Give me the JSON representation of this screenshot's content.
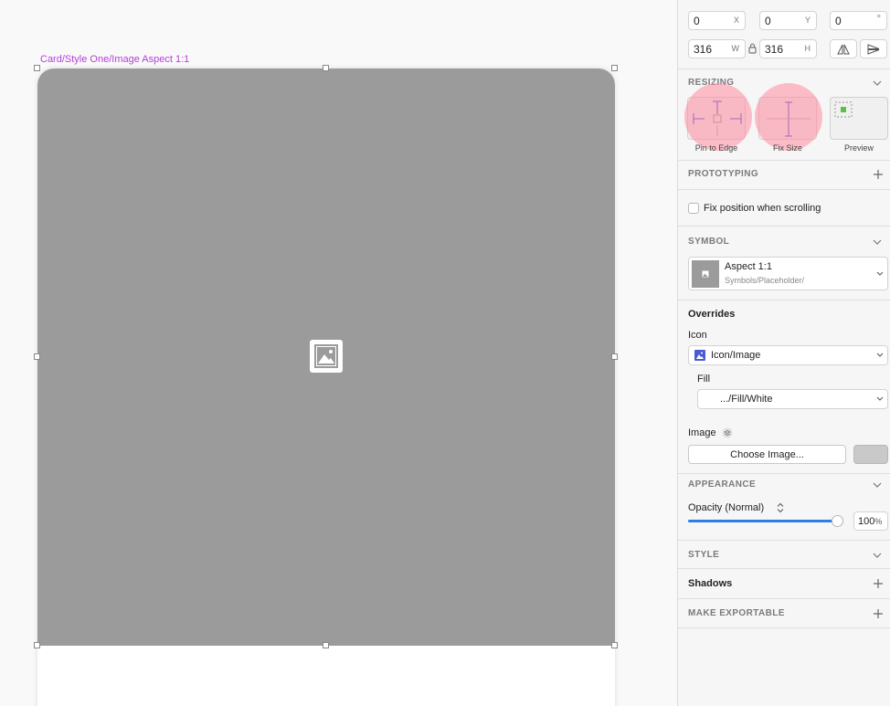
{
  "canvas": {
    "artboard_label": "Card/Style One/Image Aspect 1:1",
    "placeholder_color": "#9b9b9b",
    "label_color": "#b43fd8"
  },
  "inspector": {
    "position": {
      "x": "0",
      "x_unit": "X",
      "y": "0",
      "y_unit": "Y",
      "rotation": "0",
      "rotation_unit": "°",
      "width": "316",
      "width_unit": "W",
      "height": "316",
      "height_unit": "H"
    },
    "resizing": {
      "title": "RESIZING",
      "pin_label": "Pin to Edge",
      "fix_label": "Fix Size",
      "preview_label": "Preview"
    },
    "prototyping": {
      "title": "PROTOTYPING",
      "fix_position_label": "Fix position when scrolling"
    },
    "symbol": {
      "title": "SYMBOL",
      "name": "Aspect 1:1",
      "path": "Symbols/Placeholder/"
    },
    "overrides": {
      "title": "Overrides",
      "icon_label": "Icon",
      "icon_value": "Icon/Image",
      "fill_label": "Fill",
      "fill_value": ".../Fill/White",
      "image_label": "Image",
      "choose_image_label": "Choose Image..."
    },
    "appearance": {
      "title": "APPEARANCE",
      "opacity_label": "Opacity (Normal)",
      "opacity_value": "100",
      "opacity_unit": "%",
      "opacity_level": 1.0
    },
    "style": {
      "title": "STYLE"
    },
    "shadows": {
      "title": "Shadows"
    },
    "export": {
      "title": "MAKE EXPORTABLE"
    }
  }
}
